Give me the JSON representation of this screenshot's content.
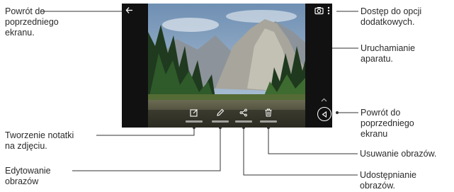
{
  "callouts": {
    "back_top": "Powrót do\npoprzedniego\nekranu.",
    "more_options": "Dostęp do opcji\ndodatkowych.",
    "camera": "Uruchamianie\naparatu.",
    "back_nav": "Powrót do\npoprzedniego\nekranu",
    "memo": "Tworzenie notatki\nna zdjęciu.",
    "delete": "Usuwanie obrazów.",
    "edit": "Edytowanie\nobrazów",
    "share": "Udostępnianie\nobrazów."
  },
  "icons": {
    "back": "back-arrow-icon",
    "camera": "camera-icon",
    "more": "more-vertical-icon",
    "memo": "memo-icon",
    "edit": "pencil-icon",
    "share": "share-icon",
    "delete": "trash-icon",
    "nav_back": "nav-back-icon",
    "expand": "chevron-up-icon"
  },
  "colors": {
    "leader_line": "#333333",
    "phone_bg": "#111111"
  }
}
